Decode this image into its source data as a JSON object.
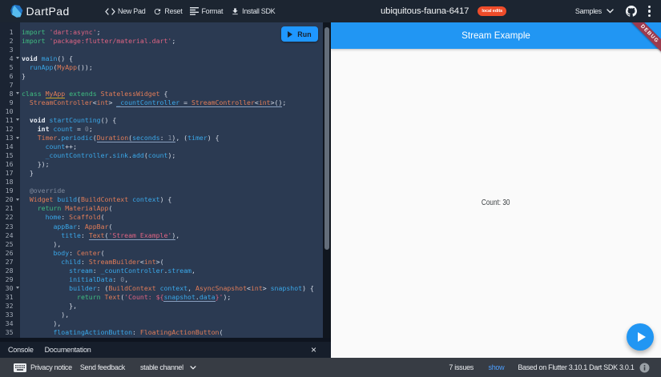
{
  "header": {
    "brand": "DartPad",
    "nav": [
      {
        "icon": "code-icon",
        "label": "New Pad"
      },
      {
        "icon": "reset-icon",
        "label": "Reset"
      },
      {
        "icon": "format-icon",
        "label": "Format"
      },
      {
        "icon": "install-icon",
        "label": "Install SDK"
      }
    ],
    "pad_title": "ubiquitous-fauna-6417",
    "badge": "local edits",
    "samples_label": "Samples"
  },
  "editor": {
    "run_label": "Run",
    "fold_lines": [
      4,
      8,
      11,
      13,
      20,
      30
    ],
    "lines": [
      {
        "n": 1,
        "tokens": [
          [
            "kw",
            "import"
          ],
          [
            "pl",
            " "
          ],
          [
            "str",
            "'dart:async'"
          ],
          [
            "pl",
            ";"
          ]
        ]
      },
      {
        "n": 2,
        "tokens": [
          [
            "kw",
            "import"
          ],
          [
            "pl",
            " "
          ],
          [
            "str",
            "'package:flutter/material.dart'"
          ],
          [
            "pl",
            ";"
          ]
        ]
      },
      {
        "n": 3,
        "tokens": []
      },
      {
        "n": 4,
        "tokens": [
          [
            "kb",
            "void"
          ],
          [
            "pl",
            " "
          ],
          [
            "id",
            "main"
          ],
          [
            "pl",
            "() {"
          ]
        ]
      },
      {
        "n": 5,
        "tokens": [
          [
            "pl",
            "  "
          ],
          [
            "id",
            "runApp"
          ],
          [
            "pl",
            "("
          ],
          [
            "ty",
            "MyApp"
          ],
          [
            "pl",
            "());"
          ]
        ]
      },
      {
        "n": 6,
        "tokens": [
          [
            "pl",
            "}"
          ]
        ]
      },
      {
        "n": 7,
        "tokens": []
      },
      {
        "n": 8,
        "tokens": [
          [
            "kw",
            "class"
          ],
          [
            "pl",
            " "
          ],
          [
            "ty uy",
            "MyApp"
          ],
          [
            "pl",
            " "
          ],
          [
            "kw",
            "extends"
          ],
          [
            "pl",
            " "
          ],
          [
            "ty",
            "StatelessWidget"
          ],
          [
            "pl",
            " {"
          ]
        ]
      },
      {
        "n": 9,
        "tokens": [
          [
            "pl",
            "  "
          ],
          [
            "ty",
            "StreamController"
          ],
          [
            "pl",
            "<"
          ],
          [
            "ty",
            "int"
          ],
          [
            "pl",
            "> "
          ],
          [
            "id u",
            "_countController"
          ],
          [
            "pl u",
            " = "
          ],
          [
            "ty u",
            "StreamController"
          ],
          [
            "pl u",
            "<"
          ],
          [
            "ty u",
            "int"
          ],
          [
            "pl u",
            ">()"
          ],
          [
            "pl",
            ";"
          ]
        ]
      },
      {
        "n": 10,
        "tokens": []
      },
      {
        "n": 11,
        "tokens": [
          [
            "pl",
            "  "
          ],
          [
            "kb",
            "void"
          ],
          [
            "pl",
            " "
          ],
          [
            "id",
            "startCounting"
          ],
          [
            "pl",
            "() {"
          ]
        ]
      },
      {
        "n": 12,
        "tokens": [
          [
            "pl",
            "    "
          ],
          [
            "kb",
            "int"
          ],
          [
            "pl",
            " "
          ],
          [
            "id",
            "count"
          ],
          [
            "pl",
            " = "
          ],
          [
            "num",
            "0"
          ],
          [
            "pl",
            ";"
          ]
        ]
      },
      {
        "n": 13,
        "tokens": [
          [
            "pl",
            "    "
          ],
          [
            "ty",
            "Timer"
          ],
          [
            "pl",
            "."
          ],
          [
            "id",
            "periodic"
          ],
          [
            "pl",
            "("
          ],
          [
            "ty u",
            "Duration"
          ],
          [
            "pl u",
            "("
          ],
          [
            "id u",
            "seconds"
          ],
          [
            "pl u",
            ": "
          ],
          [
            "num u",
            "1"
          ],
          [
            "pl u",
            ")"
          ],
          [
            "pl",
            ", ("
          ],
          [
            "id",
            "timer"
          ],
          [
            "pl",
            ") {"
          ]
        ]
      },
      {
        "n": 14,
        "tokens": [
          [
            "pl",
            "      "
          ],
          [
            "id",
            "count"
          ],
          [
            "pl",
            "++;"
          ]
        ]
      },
      {
        "n": 15,
        "tokens": [
          [
            "pl",
            "      "
          ],
          [
            "id",
            "_countController"
          ],
          [
            "pl",
            "."
          ],
          [
            "id",
            "sink"
          ],
          [
            "pl",
            "."
          ],
          [
            "id",
            "add"
          ],
          [
            "pl",
            "("
          ],
          [
            "id",
            "count"
          ],
          [
            "pl",
            ");"
          ]
        ]
      },
      {
        "n": 16,
        "tokens": [
          [
            "pl",
            "    });"
          ]
        ]
      },
      {
        "n": 17,
        "tokens": [
          [
            "pl",
            "  }"
          ]
        ]
      },
      {
        "n": 18,
        "tokens": []
      },
      {
        "n": 19,
        "tokens": [
          [
            "pl",
            "  "
          ],
          [
            "meta",
            "@override"
          ]
        ]
      },
      {
        "n": 20,
        "tokens": [
          [
            "pl",
            "  "
          ],
          [
            "ty",
            "Widget"
          ],
          [
            "pl",
            " "
          ],
          [
            "id",
            "build"
          ],
          [
            "pl",
            "("
          ],
          [
            "ty",
            "BuildContext"
          ],
          [
            "pl",
            " "
          ],
          [
            "id",
            "context"
          ],
          [
            "pl",
            ") {"
          ]
        ]
      },
      {
        "n": 21,
        "tokens": [
          [
            "pl",
            "    "
          ],
          [
            "kw",
            "return"
          ],
          [
            "pl",
            " "
          ],
          [
            "ty",
            "MaterialApp"
          ],
          [
            "pl",
            "("
          ]
        ]
      },
      {
        "n": 22,
        "tokens": [
          [
            "pl",
            "      "
          ],
          [
            "id",
            "home"
          ],
          [
            "pl",
            ": "
          ],
          [
            "ty",
            "Scaffold"
          ],
          [
            "pl",
            "("
          ]
        ]
      },
      {
        "n": 23,
        "tokens": [
          [
            "pl",
            "        "
          ],
          [
            "id",
            "appBar"
          ],
          [
            "pl",
            ": "
          ],
          [
            "ty",
            "AppBar"
          ],
          [
            "pl",
            "("
          ]
        ]
      },
      {
        "n": 24,
        "tokens": [
          [
            "pl",
            "          "
          ],
          [
            "id",
            "title"
          ],
          [
            "pl",
            ": "
          ],
          [
            "ty u",
            "Text"
          ],
          [
            "pl u",
            "("
          ],
          [
            "str u",
            "'Stream Example'"
          ],
          [
            "pl u",
            ")"
          ],
          [
            "pl",
            ","
          ]
        ]
      },
      {
        "n": 25,
        "tokens": [
          [
            "pl",
            "        ),"
          ]
        ]
      },
      {
        "n": 26,
        "tokens": [
          [
            "pl",
            "        "
          ],
          [
            "id",
            "body"
          ],
          [
            "pl",
            ": "
          ],
          [
            "ty",
            "Center"
          ],
          [
            "pl",
            "("
          ]
        ]
      },
      {
        "n": 27,
        "tokens": [
          [
            "pl",
            "          "
          ],
          [
            "id",
            "child"
          ],
          [
            "pl",
            ": "
          ],
          [
            "ty",
            "StreamBuilder"
          ],
          [
            "pl",
            "<"
          ],
          [
            "ty",
            "int"
          ],
          [
            "pl",
            ">("
          ]
        ]
      },
      {
        "n": 28,
        "tokens": [
          [
            "pl",
            "            "
          ],
          [
            "id",
            "stream"
          ],
          [
            "pl",
            ": "
          ],
          [
            "id",
            "_countController"
          ],
          [
            "pl",
            "."
          ],
          [
            "id",
            "stream"
          ],
          [
            "pl",
            ","
          ]
        ]
      },
      {
        "n": 29,
        "tokens": [
          [
            "pl",
            "            "
          ],
          [
            "id",
            "initialData"
          ],
          [
            "pl",
            ": "
          ],
          [
            "num",
            "0"
          ],
          [
            "pl",
            ","
          ]
        ]
      },
      {
        "n": 30,
        "tokens": [
          [
            "pl",
            "            "
          ],
          [
            "id",
            "builder"
          ],
          [
            "pl",
            ": ("
          ],
          [
            "ty",
            "BuildContext"
          ],
          [
            "pl",
            " "
          ],
          [
            "id",
            "context"
          ],
          [
            "pl",
            ", "
          ],
          [
            "ty",
            "AsyncSnapshot"
          ],
          [
            "pl",
            "<"
          ],
          [
            "ty",
            "int"
          ],
          [
            "pl",
            "> "
          ],
          [
            "id",
            "snapshot"
          ],
          [
            "pl",
            ") {"
          ]
        ]
      },
      {
        "n": 31,
        "tokens": [
          [
            "pl",
            "              "
          ],
          [
            "kw",
            "return"
          ],
          [
            "pl",
            " "
          ],
          [
            "ty",
            "Text"
          ],
          [
            "pl",
            "("
          ],
          [
            "str",
            "'Count: ${"
          ],
          [
            "id u",
            "snapshot"
          ],
          [
            "pl u",
            "."
          ],
          [
            "id u",
            "data"
          ],
          [
            "str",
            "}'"
          ],
          [
            "pl",
            ");"
          ]
        ]
      },
      {
        "n": 32,
        "tokens": [
          [
            "pl",
            "            },"
          ]
        ]
      },
      {
        "n": 33,
        "tokens": [
          [
            "pl",
            "          ),"
          ]
        ]
      },
      {
        "n": 34,
        "tokens": [
          [
            "pl",
            "        ),"
          ]
        ]
      },
      {
        "n": 35,
        "tokens": [
          [
            "pl",
            "        "
          ],
          [
            "id",
            "floatingActionButton"
          ],
          [
            "pl",
            ": "
          ],
          [
            "ty",
            "FloatingActionButton"
          ],
          [
            "pl",
            "("
          ]
        ]
      }
    ]
  },
  "console": {
    "tabs": [
      "Console",
      "Documentation"
    ],
    "close": "×"
  },
  "preview": {
    "appbar_title": "Stream Example",
    "debug_banner": "DEBUG",
    "body_text": "Count: 30"
  },
  "footer": {
    "privacy": "Privacy notice",
    "feedback": "Send feedback",
    "channel": "stable channel",
    "issues": "7 issues",
    "show": "show",
    "based": "Based on Flutter 3.10.1 Dart SDK 3.0.1"
  },
  "colors": {
    "accent_blue": "#2196f3",
    "run_blue": "#1f97ff",
    "badge_orange": "#ee4c2a",
    "editor_bg": "#2b3a52",
    "header_bg": "#1c2531",
    "footer_bg": "#373c44",
    "debug_ribbon": "#9c3a4e",
    "syntax_keyword_green": "#3fbe81",
    "syntax_identifier_blue": "#3aa7e8",
    "syntax_type_orange": "#e07c58",
    "syntax_string_rose": "#df6483",
    "syntax_muted_grey": "#7e899c"
  }
}
